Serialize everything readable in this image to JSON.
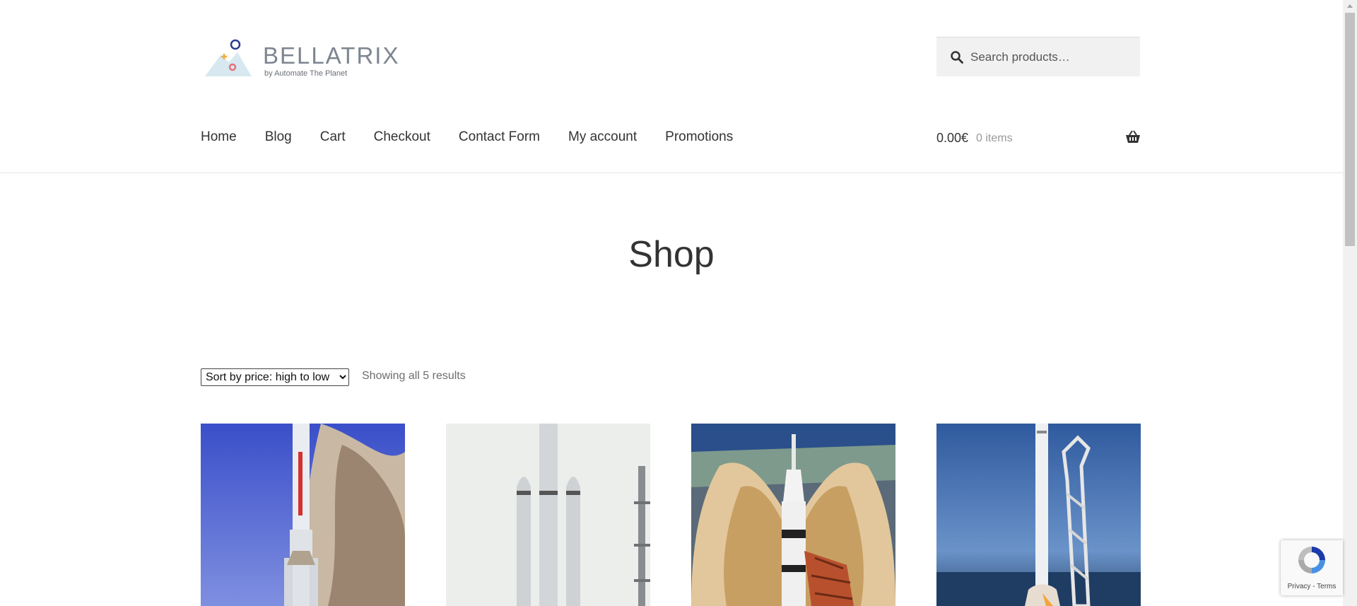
{
  "brand": {
    "name": "BELLATRIX",
    "tagline": "by Automate The Planet"
  },
  "search": {
    "placeholder": "Search products…"
  },
  "nav": {
    "items": [
      {
        "label": "Home"
      },
      {
        "label": "Blog"
      },
      {
        "label": "Cart"
      },
      {
        "label": "Checkout"
      },
      {
        "label": "Contact Form"
      },
      {
        "label": "My account"
      },
      {
        "label": "Promotions"
      }
    ]
  },
  "cart": {
    "total": "0.00€",
    "count": "0 items",
    "icon": "basket-icon"
  },
  "page": {
    "title": "Shop"
  },
  "toolbar": {
    "sort_selected": "Sort by price: high to low",
    "result_count": "Showing all 5 results"
  },
  "products": [
    {
      "image": "proton-rocket-launch"
    },
    {
      "image": "falcon-heavy-rocket"
    },
    {
      "image": "saturn-v-launch"
    },
    {
      "image": "falcon-9-launch"
    }
  ],
  "recaptcha": {
    "links": "Privacy - Terms"
  },
  "colors": {
    "text": "#333333",
    "muted": "#9a9a9a",
    "search_bg": "#f1f1f1"
  }
}
